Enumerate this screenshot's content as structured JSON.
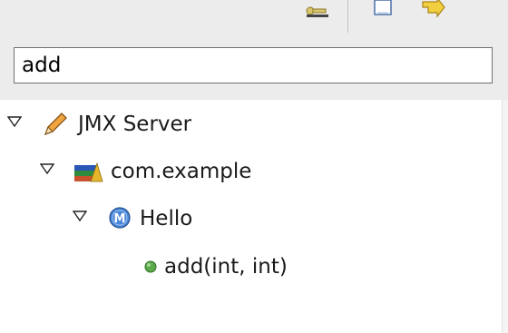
{
  "filter": {
    "value": "add"
  },
  "toolbar": {
    "buttons": [
      {
        "icon": "pin-icon"
      },
      {
        "icon": "new-document-icon"
      },
      {
        "icon": "next-arrow-icon"
      }
    ]
  },
  "tree": {
    "server": {
      "label": "JMX Server",
      "icon": "pencil-icon",
      "expanded": true
    },
    "domain": {
      "label": "com.example",
      "icon": "books-icon",
      "expanded": true
    },
    "mbean": {
      "label": "Hello",
      "icon": "mbean-icon",
      "badge": "M",
      "expanded": true
    },
    "operation": {
      "label": "add(int, int)",
      "icon": "green-dot-icon"
    }
  },
  "colors": {
    "panel_bg": "#ececec",
    "mbean_blue": "#4a86d8",
    "operation_green": "#5aaa4c",
    "pencil_orange": "#e58a1f"
  }
}
